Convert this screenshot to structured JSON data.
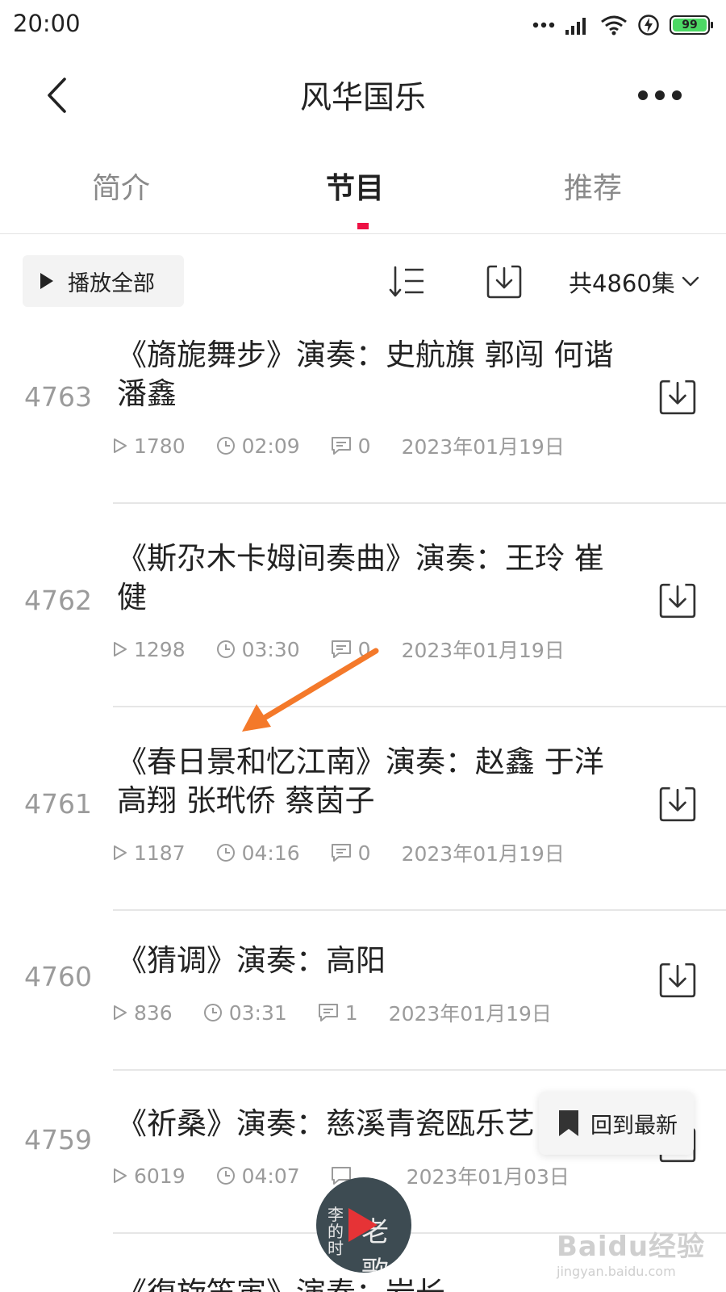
{
  "status_bar": {
    "time": "20:00",
    "battery": "99"
  },
  "header": {
    "title": "风华国乐"
  },
  "tabs": [
    {
      "label": "简介",
      "active": false
    },
    {
      "label": "节目",
      "active": true
    },
    {
      "label": "推荐",
      "active": false
    }
  ],
  "toolbar": {
    "play_all": "播放全部",
    "total": "共4860集"
  },
  "episodes": [
    {
      "number": "4763",
      "title": "《旖旎舞步》演奏：史航旗 郭闯 何谐 潘鑫",
      "plays": "1780",
      "duration": "02:09",
      "comments": "0",
      "date": "2023年01月19日"
    },
    {
      "number": "4762",
      "title": "《斯尕木卡姆间奏曲》演奏：王玲 崔健",
      "plays": "1298",
      "duration": "03:30",
      "comments": "0",
      "date": "2023年01月19日"
    },
    {
      "number": "4761",
      "title": "《春日景和忆江南》演奏：赵鑫 于洋 高翔 张玳侨 蔡茵子",
      "plays": "1187",
      "duration": "04:16",
      "comments": "0",
      "date": "2023年01月19日"
    },
    {
      "number": "4760",
      "title": "《猜调》演奏：高阳",
      "plays": "836",
      "duration": "03:31",
      "comments": "1",
      "date": "2023年01月19日"
    },
    {
      "number": "4759",
      "title": "《祈桑》演奏：慈溪青瓷瓯乐艺",
      "plays": "6019",
      "duration": "04:07",
      "comments": "",
      "date": "2023年01月03日"
    },
    {
      "number": "",
      "title": "《復旋笛寅》演奏：岩长",
      "plays": "",
      "duration": "",
      "comments": "",
      "date": ""
    }
  ],
  "back_to_latest": "回到最新",
  "mini_player": {
    "cover_left": "李的时",
    "cover_right": "老歌"
  },
  "watermark": {
    "brand": "Baidu经验",
    "url": "jingyan.baidu.com"
  },
  "colors": {
    "accent": "#ee1144",
    "arrow": "#f4792a"
  }
}
